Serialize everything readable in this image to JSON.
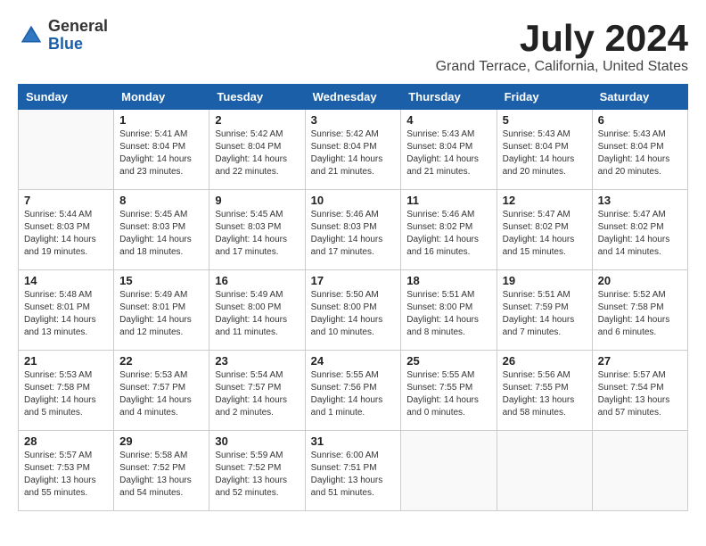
{
  "logo": {
    "general": "General",
    "blue": "Blue"
  },
  "title": "July 2024",
  "location": "Grand Terrace, California, United States",
  "headers": [
    "Sunday",
    "Monday",
    "Tuesday",
    "Wednesday",
    "Thursday",
    "Friday",
    "Saturday"
  ],
  "weeks": [
    [
      {
        "day": "",
        "info": ""
      },
      {
        "day": "1",
        "info": "Sunrise: 5:41 AM\nSunset: 8:04 PM\nDaylight: 14 hours\nand 23 minutes."
      },
      {
        "day": "2",
        "info": "Sunrise: 5:42 AM\nSunset: 8:04 PM\nDaylight: 14 hours\nand 22 minutes."
      },
      {
        "day": "3",
        "info": "Sunrise: 5:42 AM\nSunset: 8:04 PM\nDaylight: 14 hours\nand 21 minutes."
      },
      {
        "day": "4",
        "info": "Sunrise: 5:43 AM\nSunset: 8:04 PM\nDaylight: 14 hours\nand 21 minutes."
      },
      {
        "day": "5",
        "info": "Sunrise: 5:43 AM\nSunset: 8:04 PM\nDaylight: 14 hours\nand 20 minutes."
      },
      {
        "day": "6",
        "info": "Sunrise: 5:43 AM\nSunset: 8:04 PM\nDaylight: 14 hours\nand 20 minutes."
      }
    ],
    [
      {
        "day": "7",
        "info": "Sunrise: 5:44 AM\nSunset: 8:03 PM\nDaylight: 14 hours\nand 19 minutes."
      },
      {
        "day": "8",
        "info": "Sunrise: 5:45 AM\nSunset: 8:03 PM\nDaylight: 14 hours\nand 18 minutes."
      },
      {
        "day": "9",
        "info": "Sunrise: 5:45 AM\nSunset: 8:03 PM\nDaylight: 14 hours\nand 17 minutes."
      },
      {
        "day": "10",
        "info": "Sunrise: 5:46 AM\nSunset: 8:03 PM\nDaylight: 14 hours\nand 17 minutes."
      },
      {
        "day": "11",
        "info": "Sunrise: 5:46 AM\nSunset: 8:02 PM\nDaylight: 14 hours\nand 16 minutes."
      },
      {
        "day": "12",
        "info": "Sunrise: 5:47 AM\nSunset: 8:02 PM\nDaylight: 14 hours\nand 15 minutes."
      },
      {
        "day": "13",
        "info": "Sunrise: 5:47 AM\nSunset: 8:02 PM\nDaylight: 14 hours\nand 14 minutes."
      }
    ],
    [
      {
        "day": "14",
        "info": "Sunrise: 5:48 AM\nSunset: 8:01 PM\nDaylight: 14 hours\nand 13 minutes."
      },
      {
        "day": "15",
        "info": "Sunrise: 5:49 AM\nSunset: 8:01 PM\nDaylight: 14 hours\nand 12 minutes."
      },
      {
        "day": "16",
        "info": "Sunrise: 5:49 AM\nSunset: 8:00 PM\nDaylight: 14 hours\nand 11 minutes."
      },
      {
        "day": "17",
        "info": "Sunrise: 5:50 AM\nSunset: 8:00 PM\nDaylight: 14 hours\nand 10 minutes."
      },
      {
        "day": "18",
        "info": "Sunrise: 5:51 AM\nSunset: 8:00 PM\nDaylight: 14 hours\nand 8 minutes."
      },
      {
        "day": "19",
        "info": "Sunrise: 5:51 AM\nSunset: 7:59 PM\nDaylight: 14 hours\nand 7 minutes."
      },
      {
        "day": "20",
        "info": "Sunrise: 5:52 AM\nSunset: 7:58 PM\nDaylight: 14 hours\nand 6 minutes."
      }
    ],
    [
      {
        "day": "21",
        "info": "Sunrise: 5:53 AM\nSunset: 7:58 PM\nDaylight: 14 hours\nand 5 minutes."
      },
      {
        "day": "22",
        "info": "Sunrise: 5:53 AM\nSunset: 7:57 PM\nDaylight: 14 hours\nand 4 minutes."
      },
      {
        "day": "23",
        "info": "Sunrise: 5:54 AM\nSunset: 7:57 PM\nDaylight: 14 hours\nand 2 minutes."
      },
      {
        "day": "24",
        "info": "Sunrise: 5:55 AM\nSunset: 7:56 PM\nDaylight: 14 hours\nand 1 minute."
      },
      {
        "day": "25",
        "info": "Sunrise: 5:55 AM\nSunset: 7:55 PM\nDaylight: 14 hours\nand 0 minutes."
      },
      {
        "day": "26",
        "info": "Sunrise: 5:56 AM\nSunset: 7:55 PM\nDaylight: 13 hours\nand 58 minutes."
      },
      {
        "day": "27",
        "info": "Sunrise: 5:57 AM\nSunset: 7:54 PM\nDaylight: 13 hours\nand 57 minutes."
      }
    ],
    [
      {
        "day": "28",
        "info": "Sunrise: 5:57 AM\nSunset: 7:53 PM\nDaylight: 13 hours\nand 55 minutes."
      },
      {
        "day": "29",
        "info": "Sunrise: 5:58 AM\nSunset: 7:52 PM\nDaylight: 13 hours\nand 54 minutes."
      },
      {
        "day": "30",
        "info": "Sunrise: 5:59 AM\nSunset: 7:52 PM\nDaylight: 13 hours\nand 52 minutes."
      },
      {
        "day": "31",
        "info": "Sunrise: 6:00 AM\nSunset: 7:51 PM\nDaylight: 13 hours\nand 51 minutes."
      },
      {
        "day": "",
        "info": ""
      },
      {
        "day": "",
        "info": ""
      },
      {
        "day": "",
        "info": ""
      }
    ]
  ]
}
